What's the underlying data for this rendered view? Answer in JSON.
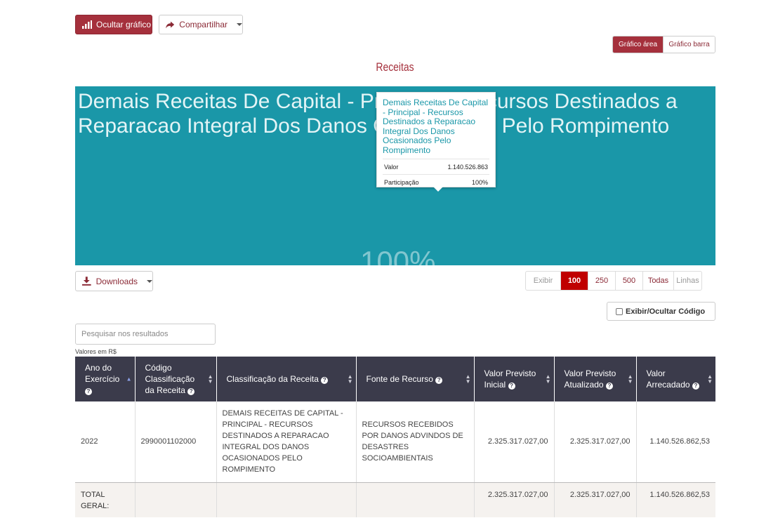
{
  "toolbar": {
    "hide_chart_label": "Ocultar gráfico",
    "share_label": "Compartilhar",
    "chart_area_label": "Gráfico área",
    "chart_bar_label": "Gráfico barra"
  },
  "chart": {
    "title": "Receitas",
    "tile_label": "Demais Receitas De Capital - Principal - Recursos Destinados a Reparacao Integral Dos Danos Ocasionados Pelo Rompimento",
    "tile_percent": "100%",
    "tooltip": {
      "title": "Demais Receitas De Capital - Principal - Recursos Destinados a Reparacao Integral Dos Danos Ocasionados Pelo Rompimento",
      "value_label": "Valor",
      "value": "1.140.526.863",
      "share_label": "Participação",
      "share": "100%"
    },
    "colors": {
      "tile": "#1a97a8",
      "accent": "#a5303c"
    }
  },
  "chart_data": {
    "type": "treemap",
    "title": "Receitas",
    "series": [
      {
        "label": "Demais Receitas De Capital - Principal - Recursos Destinados a Reparacao Integral Dos Danos Ocasionados Pelo Rompimento",
        "value": 1140526863,
        "share": 100
      }
    ]
  },
  "controls": {
    "downloads_label": "Downloads",
    "page_size_label": "Exibir",
    "page_sizes": [
      "100",
      "250",
      "500",
      "Todas"
    ],
    "page_size_selected": "100",
    "page_size_suffix": "Linhas",
    "toggle_code_label": "Exibir/Ocultar Código",
    "search_placeholder": "Pesquisar nos resultados",
    "values_note": "Valores em R$"
  },
  "table": {
    "headers": {
      "year": "Ano do Exercício",
      "code": "Código Classificação da Receita",
      "classification": "Classificação da Receita",
      "source": "Fonte de Recurso",
      "initial": "Valor Previsto Inicial",
      "updated": "Valor Previsto Atualizado",
      "collected": "Valor Arrecadado"
    },
    "rows": [
      {
        "year": "2022",
        "code": "2990001102000",
        "classification": "DEMAIS RECEITAS DE CAPITAL - PRINCIPAL - RECURSOS DESTINADOS A REPARACAO INTEGRAL DOS DANOS OCASIONADOS PELO ROMPIMENTO",
        "source": "RECURSOS RECEBIDOS POR DANOS ADVINDOS DE DESASTRES SOCIOAMBIENTAIS",
        "initial": "2.325.317.027,00",
        "updated": "2.325.317.027,00",
        "collected": "1.140.526.862,53"
      }
    ],
    "total": {
      "label": "TOTAL GERAL:",
      "initial": "2.325.317.027,00",
      "updated": "2.325.317.027,00",
      "collected": "1.140.526.862,53"
    }
  }
}
